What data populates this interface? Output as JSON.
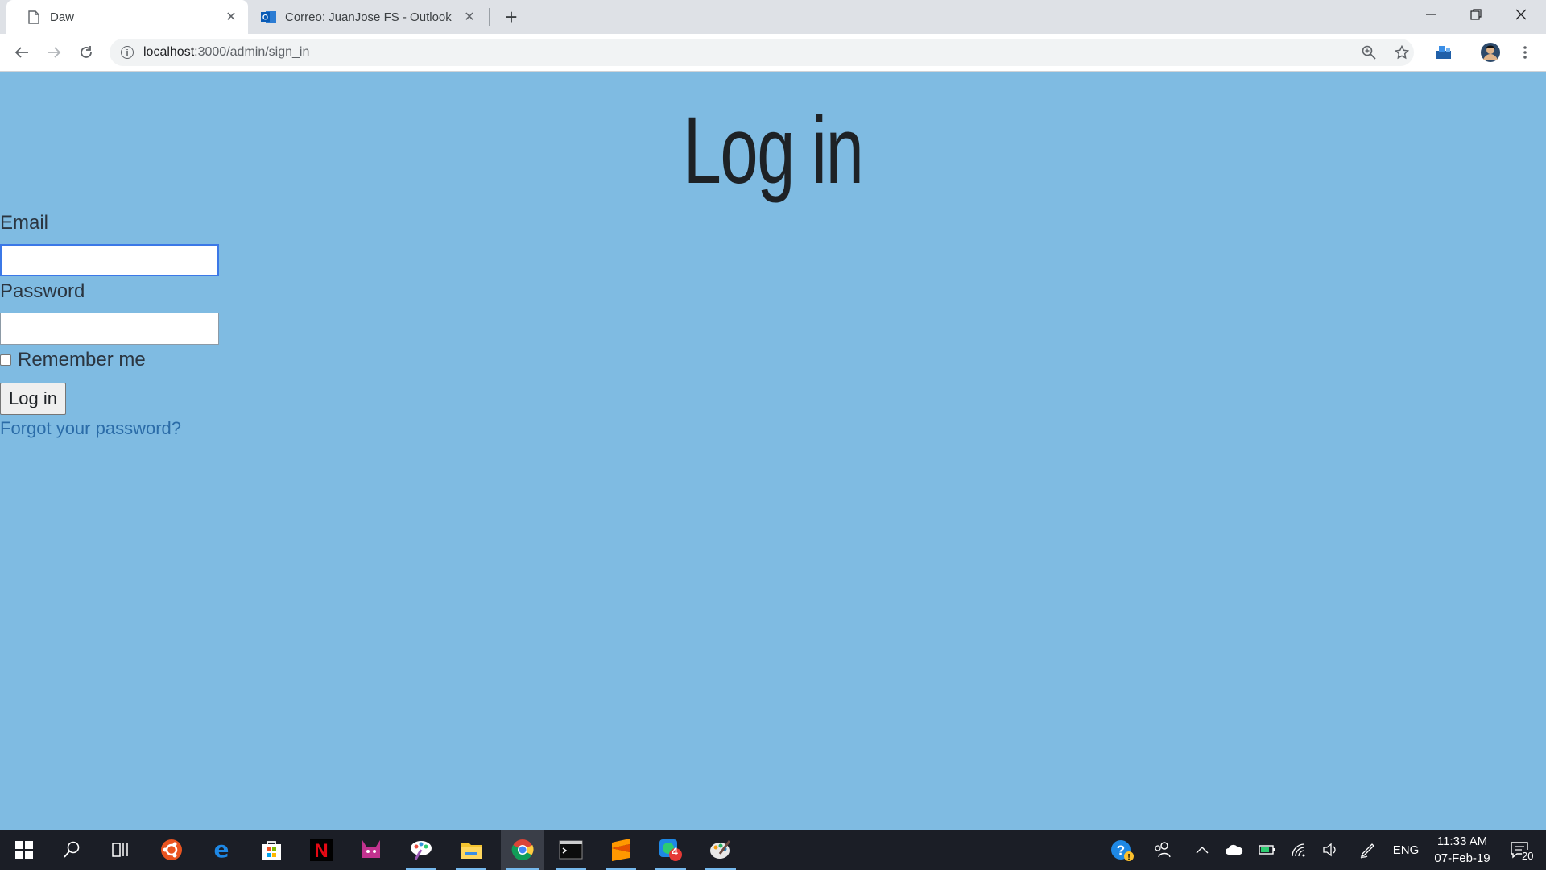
{
  "browser": {
    "tabs": [
      {
        "title": "Daw",
        "active": true,
        "icon": "page-icon"
      },
      {
        "title": "Correo: JuanJose FS - Outlook",
        "active": false,
        "icon": "outlook-icon"
      }
    ],
    "address": {
      "host": "localhost",
      "path": ":3000/admin/sign_in"
    }
  },
  "page": {
    "heading": "Log in",
    "email_label": "Email",
    "email_value": "",
    "password_label": "Password",
    "password_value": "",
    "remember_label": "Remember me",
    "remember_checked": false,
    "submit_label": "Log in",
    "forgot_link": "Forgot your password?"
  },
  "taskbar": {
    "apps": [
      "start-icon",
      "search-icon",
      "task-view-icon",
      "ubuntu-icon",
      "edge-icon",
      "store-icon",
      "netflix-icon",
      "game-icon",
      "paint-icon",
      "file-explorer-icon",
      "chrome-icon",
      "terminal-icon",
      "sublime-icon",
      "whatsapp-icon",
      "paint3d-icon"
    ],
    "whatsapp_badge": "4",
    "language": "ENG",
    "time": "11:33 AM",
    "date": "07-Feb-19",
    "notifications": "20"
  },
  "colors": {
    "page_bg": "#7fbbe2",
    "link": "#2b6ca8",
    "focus": "#3b78e7"
  }
}
